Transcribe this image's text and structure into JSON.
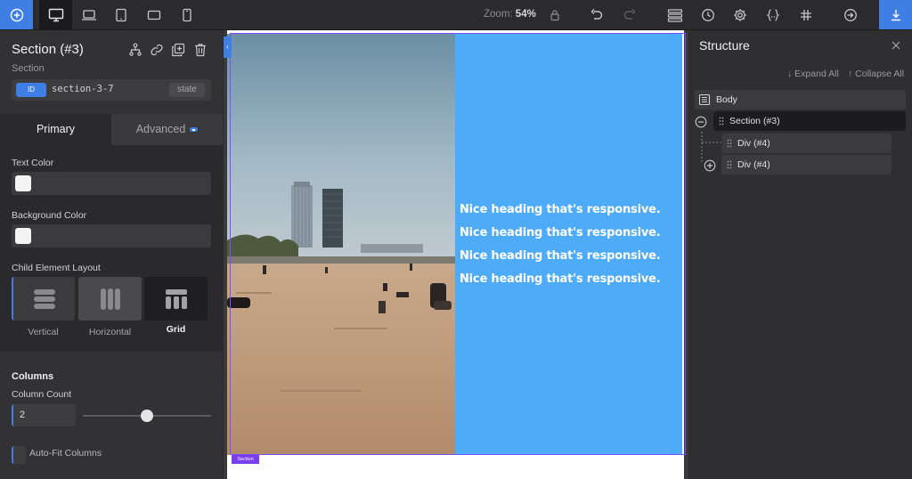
{
  "topbar": {
    "zoom_label": "Zoom:",
    "zoom_value": "54%"
  },
  "element": {
    "title": "Section (#3)",
    "type_label": "Section",
    "id_badge": "ID",
    "id_value": "section-3-7",
    "state_label": "state"
  },
  "tabs": {
    "primary": "Primary",
    "advanced": "Advanced"
  },
  "properties": {
    "text_color_label": "Text Color",
    "text_color_value": "#f4f4f4",
    "background_color_label": "Background Color",
    "background_color_value": "#f4f4f4",
    "child_layout_label": "Child Element Layout",
    "layout_options": [
      "Vertical",
      "Horizontal",
      "Grid"
    ],
    "layout_selected": "Grid",
    "columns_heading": "Columns",
    "column_count_label": "Column Count",
    "column_count_value": "2",
    "auto_fit_label": "Auto-Fit Columns"
  },
  "canvas": {
    "heading_text": "Nice heading that's responsive.",
    "heading_repeat": 4,
    "heading_color": "#ffffff",
    "blue_bg": "#4dabf7",
    "selection_tag": "Section",
    "selection_color": "#7a3df0"
  },
  "structure": {
    "title": "Structure",
    "expand_all": "↓ Expand All",
    "collapse_all": "↑ Collapse All",
    "nodes": {
      "body": "Body",
      "section": "Section (#3)",
      "div1": "Div (#4)",
      "div2": "Div (#4)"
    }
  },
  "colors": {
    "accent": "#3f7fe5",
    "panel_bg": "#323234"
  }
}
